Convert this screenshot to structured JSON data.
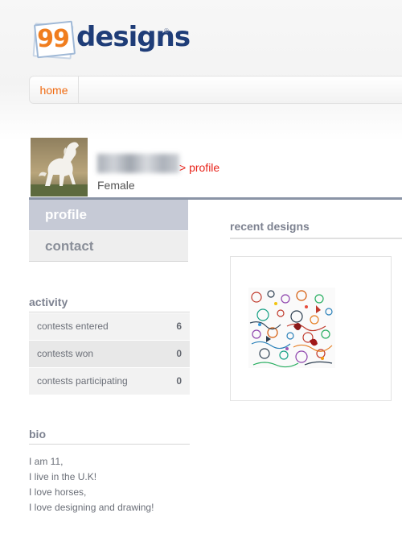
{
  "logo": {
    "number": "99",
    "word": "designs",
    "reg": "®"
  },
  "nav": {
    "home_label": "home"
  },
  "profile": {
    "link_label": "> profile",
    "gender": "Female"
  },
  "menu": {
    "profile_label": "profile",
    "contact_label": "contact"
  },
  "activity": {
    "title": "activity",
    "rows": [
      {
        "label": "contests entered",
        "count": "6"
      },
      {
        "label": "contests won",
        "count": "0"
      },
      {
        "label": "contests participating",
        "count": "0"
      }
    ]
  },
  "bio": {
    "title": "bio",
    "lines": [
      "I am 11,",
      "I live in the U.K!",
      "I love horses,",
      "I love designing and drawing!"
    ]
  },
  "recent": {
    "title": "recent designs"
  },
  "colors": {
    "accent_orange": "#f06a10",
    "link_red": "#e8231a",
    "menu_active": "#c6cad6",
    "logo_blue": "#1f3d78"
  }
}
